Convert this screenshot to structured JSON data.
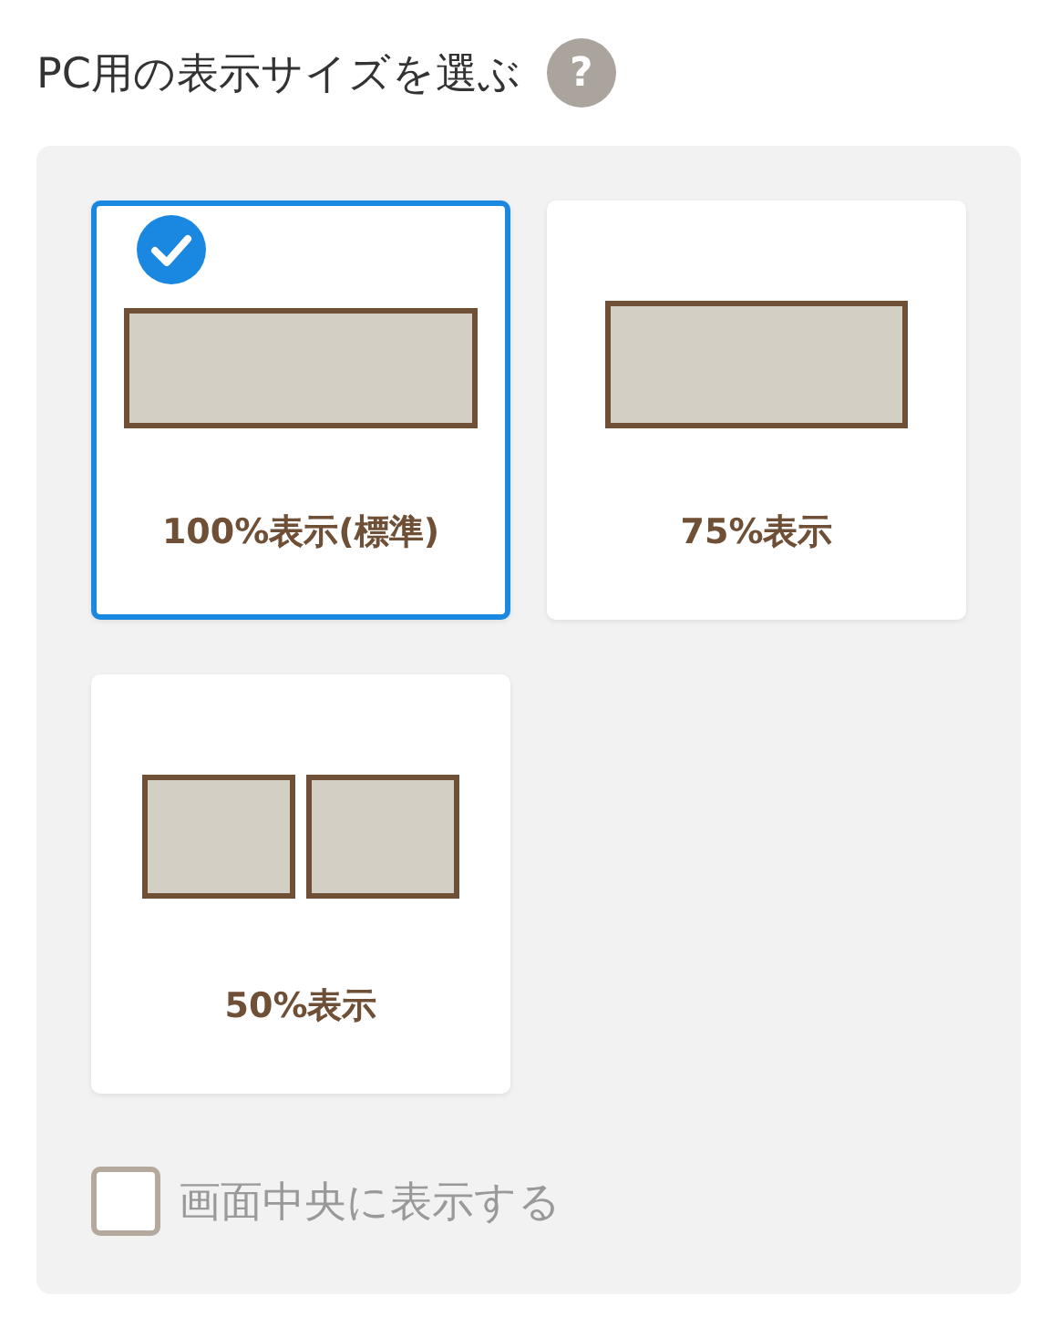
{
  "heading": {
    "title": "PC用の表示サイズを選ぶ",
    "help": "?"
  },
  "options": [
    {
      "label": "100%表示(標準)",
      "selected": true,
      "kind": "large"
    },
    {
      "label": "75%表示",
      "selected": false,
      "kind": "medium"
    },
    {
      "label": "50%表示",
      "selected": false,
      "kind": "split"
    }
  ],
  "center_option": {
    "label": "画面中央に表示する",
    "checked": false
  }
}
